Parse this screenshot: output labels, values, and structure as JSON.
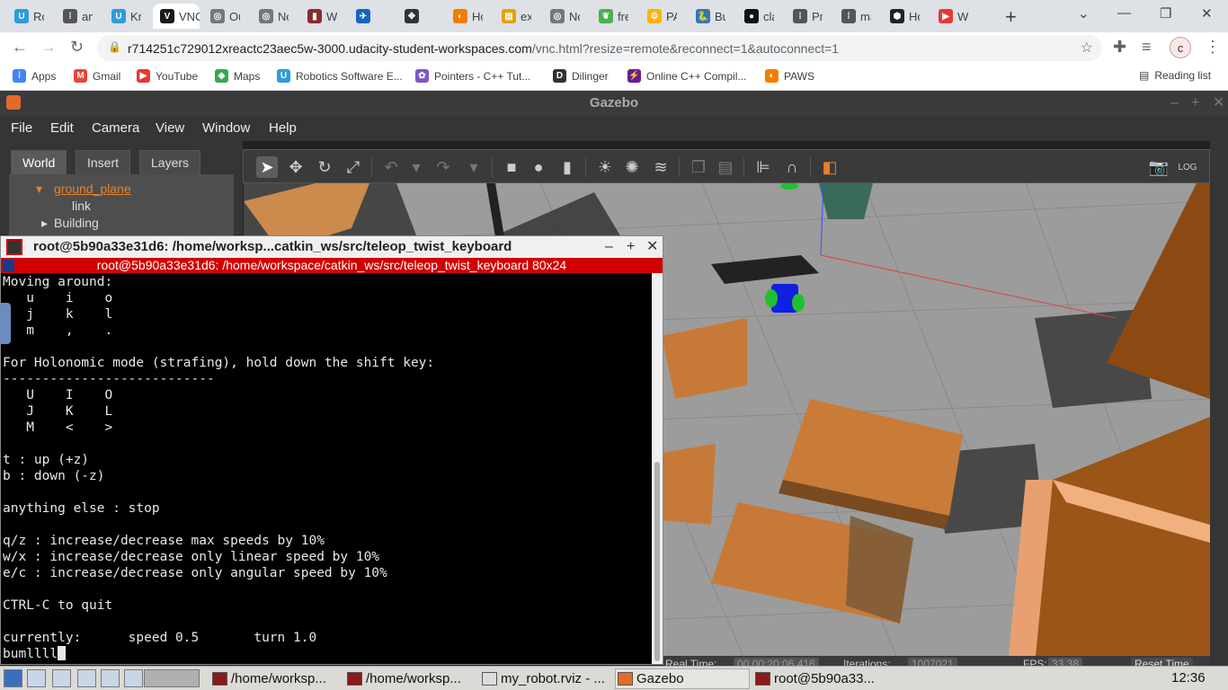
{
  "browser": {
    "tabs": [
      {
        "label": "Rol",
        "color": "#2d9cdb",
        "glyph": "U"
      },
      {
        "label": "am",
        "color": "#555555",
        "glyph": "⁞"
      },
      {
        "label": "Kno",
        "color": "#2d9cdb",
        "glyph": "U"
      },
      {
        "label": "VNC",
        "color": "#1a1a1a",
        "glyph": "V",
        "active": true
      },
      {
        "label": "Out",
        "color": "#777777",
        "glyph": "◎"
      },
      {
        "label": "No",
        "color": "#777777",
        "glyph": "◎"
      },
      {
        "label": "Wik",
        "color": "#8b2b2b",
        "glyph": "▮"
      },
      {
        "label": "",
        "color": "#1565c0",
        "glyph": "✈"
      },
      {
        "label": "",
        "color": "#333333",
        "glyph": "✥"
      },
      {
        "label": "Ho",
        "color": "#f57c00",
        "glyph": "◐"
      },
      {
        "label": "exa",
        "color": "#e6a000",
        "glyph": "▤"
      },
      {
        "label": "No",
        "color": "#777777",
        "glyph": "◎"
      },
      {
        "label": "fre",
        "color": "#4caf50",
        "glyph": "❦"
      },
      {
        "label": "PAV",
        "color": "#ffb300",
        "glyph": "⚙"
      },
      {
        "label": "Bui",
        "color": "#3776ab",
        "glyph": "🐍"
      },
      {
        "label": "cla",
        "color": "#111111",
        "glyph": "●"
      },
      {
        "label": "Pro",
        "color": "#555555",
        "glyph": "⁞"
      },
      {
        "label": "ma",
        "color": "#555555",
        "glyph": "⁞"
      },
      {
        "label": "Ho",
        "color": "#222222",
        "glyph": "⬢"
      },
      {
        "label": "We",
        "color": "#e53935",
        "glyph": "▶"
      }
    ],
    "url_host": "r714251c729012xreactc23aec5w-3000.udacity-student-workspaces.com",
    "url_path": "/vnc.html?resize=remote&reconnect=1&autoconnect=1",
    "avatar_letter": "c",
    "bookmarks": [
      {
        "label": "Apps",
        "color": "#4285f4",
        "glyph": "⁞"
      },
      {
        "label": "Gmail",
        "color": "#ea4335",
        "glyph": "M"
      },
      {
        "label": "YouTube",
        "color": "#e53935",
        "glyph": "▶"
      },
      {
        "label": "Maps",
        "color": "#34a853",
        "glyph": "◆"
      },
      {
        "label": "Robotics Software E...",
        "color": "#2d9cdb",
        "glyph": "U"
      },
      {
        "label": "Pointers - C++ Tut...",
        "color": "#7e57c2",
        "glyph": "✿"
      },
      {
        "label": "Dilinger",
        "color": "#333333",
        "glyph": "D"
      },
      {
        "label": "Online C++ Compil...",
        "color": "#6a1b9a",
        "glyph": "⚡"
      },
      {
        "label": "PAWS",
        "color": "#f57c00",
        "glyph": "◐"
      }
    ],
    "reading_list": "Reading list"
  },
  "gazebo": {
    "title": "Gazebo",
    "menu": [
      "File",
      "Edit",
      "Camera",
      "View",
      "Window",
      "Help"
    ],
    "left_tabs": [
      "World",
      "Insert",
      "Layers"
    ],
    "tree": {
      "item1": "ground_plane",
      "item1_child": "link",
      "item2": "Building"
    },
    "status": {
      "real_time_label": "Real Time:",
      "real_time": "00 00:20:06.416",
      "iterations_label": "Iterations:",
      "iterations": "1007021",
      "fps_label": "FPS:",
      "fps": "33.38",
      "reset": "Reset Time"
    }
  },
  "terminal": {
    "title": "root@5b90a33e31d6: /home/worksp...catkin_ws/src/teleop_twist_keyboard",
    "subtitle": "root@5b90a33e31d6: /home/workspace/catkin_ws/src/teleop_twist_keyboard 80x24",
    "lines": [
      "Moving around:",
      "   u    i    o",
      "   j    k    l",
      "   m    ,    .",
      "",
      "For Holonomic mode (strafing), hold down the shift key:",
      "---------------------------",
      "   U    I    O",
      "   J    K    L",
      "   M    <    >",
      "",
      "t : up (+z)",
      "b : down (-z)",
      "",
      "anything else : stop",
      "",
      "q/z : increase/decrease max speeds by 10%",
      "w/x : increase/decrease only linear speed by 10%",
      "e/c : increase/decrease only angular speed by 10%",
      "",
      "CTRL-C to quit",
      "",
      "currently:      speed 0.5       turn 1.0"
    ],
    "prompt": "bumllll"
  },
  "taskbar": {
    "items": [
      "/home/worksp...",
      "/home/worksp...",
      "my_robot.rviz - ...",
      "Gazebo",
      "root@5b90a33..."
    ],
    "clock": "12:36"
  }
}
